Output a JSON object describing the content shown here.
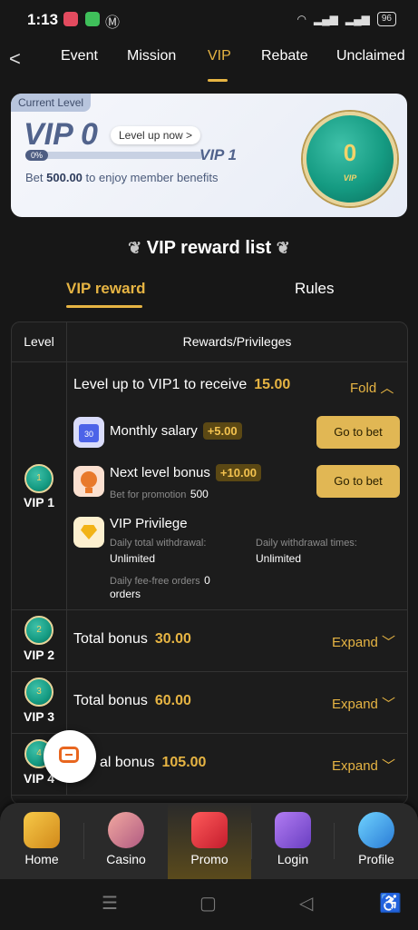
{
  "status": {
    "time": "1:13",
    "battery": "96"
  },
  "nav": {
    "tabs": [
      "Event",
      "Mission",
      "VIP",
      "Rebate",
      "Unclaimed"
    ]
  },
  "card": {
    "current_label": "Current Level",
    "level": "VIP 0",
    "level_up": "Level up now >",
    "progress_pct": "0%",
    "progress_value": 0,
    "next_level": "VIP 1",
    "bet_prefix": "Bet",
    "bet_amount": "500.00",
    "bet_suffix": "to enjoy member benefits",
    "medal_value": "0",
    "medal_text": "VIP"
  },
  "section": {
    "title": "VIP reward list",
    "tab_reward": "VIP reward",
    "tab_rules": "Rules"
  },
  "table": {
    "col_level": "Level",
    "col_rewards": "Rewards/Privileges",
    "vip1": {
      "level": "VIP 1",
      "badge": "1",
      "receive_text": "Level up to VIP1 to receive",
      "receive_amount": "15.00",
      "fold": "Fold",
      "monthly_salary": "Monthly salary",
      "monthly_salary_amount": "+5.00",
      "calendar_day": "30",
      "go_to_bet": "Go to bet",
      "next_level_bonus": "Next level bonus",
      "next_level_bonus_amount": "+10.00",
      "bet_for_promotion": "Bet for promotion",
      "bet_for_promotion_value": "500",
      "vip_privilege": "VIP Privilege",
      "daily_total_withdrawal": "Daily total withdrawal:",
      "daily_total_withdrawal_value": "Unlimited",
      "daily_withdrawal_times": "Daily withdrawal times:",
      "daily_withdrawal_times_value": "Unlimited",
      "daily_fee_free": "Daily fee-free orders",
      "daily_fee_free_value": "0",
      "orders": "orders"
    },
    "rows": [
      {
        "level": "VIP 2",
        "badge": "2",
        "label": "Total bonus",
        "amount": "30.00",
        "expand": "Expand"
      },
      {
        "level": "VIP 3",
        "badge": "3",
        "label": "Total bonus",
        "amount": "60.00",
        "expand": "Expand"
      },
      {
        "level": "VIP 4",
        "badge": "4",
        "label": "al bonus",
        "amount": "105.00",
        "expand": "Expand"
      }
    ]
  },
  "bottom_nav": [
    "Home",
    "Casino",
    "Promo",
    "Login",
    "Profile"
  ],
  "colors": {
    "accent": "#e6b443",
    "background": "#171717"
  }
}
